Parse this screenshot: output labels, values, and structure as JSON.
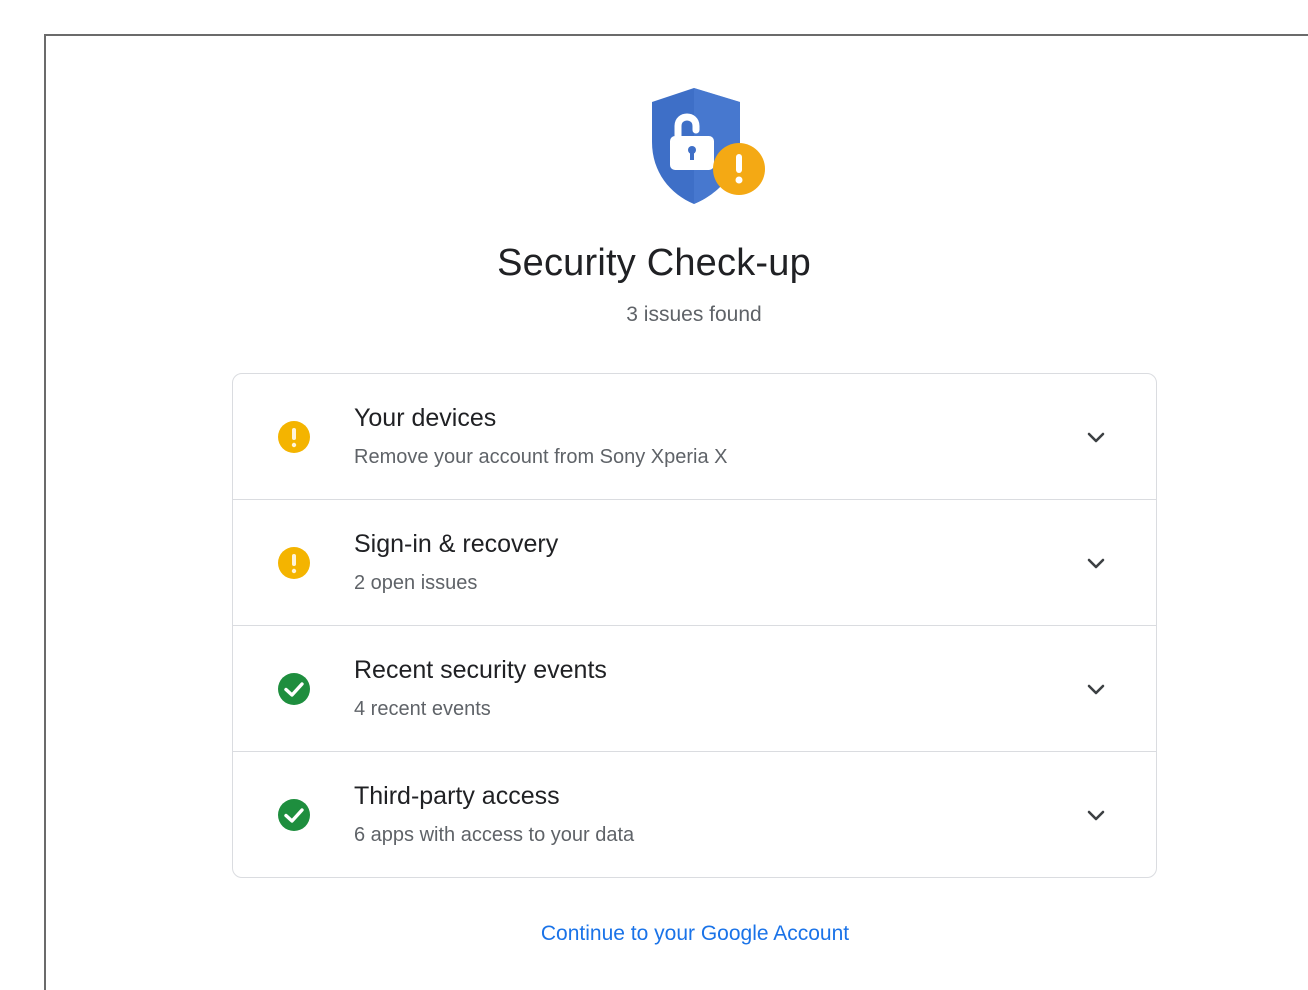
{
  "page": {
    "title": "Security Check-up",
    "subtitle": "3 issues found"
  },
  "hero": {
    "icon": "shield-lock-warning-icon",
    "colors": {
      "shield": "#3e6fc7",
      "badge": "#f4a914"
    }
  },
  "items": [
    {
      "title": "Your devices",
      "description": "Remove your account from Sony Xperia X",
      "status": "warning",
      "icon": "warning-icon"
    },
    {
      "title": "Sign-in & recovery",
      "description": "2 open issues",
      "status": "warning",
      "icon": "warning-icon"
    },
    {
      "title": "Recent security events",
      "description": "4 recent events",
      "status": "ok",
      "icon": "check-circle-icon"
    },
    {
      "title": "Third-party access",
      "description": "6 apps with access to your data",
      "status": "ok",
      "icon": "check-circle-icon"
    }
  ],
  "footer": {
    "continue_label": "Continue to your Google Account"
  },
  "colors": {
    "warning": "#f4b400",
    "ok": "#1e8e3e",
    "link": "#1a73e8",
    "text_primary": "#202124",
    "text_secondary": "#5f6368",
    "divider": "#dadce0"
  }
}
